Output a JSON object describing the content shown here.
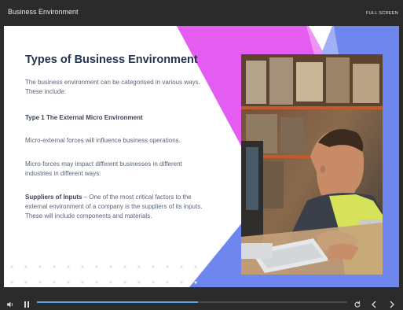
{
  "window": {
    "title": "Business Environment",
    "fullscreen_label": "FULL SCREEN"
  },
  "slide": {
    "heading": "Types of Business Environment",
    "intro": "The business environment can be categorised in various ways. These include:",
    "subheading": "Type 1 The External Micro Environment",
    "para1": "Micro-external forces will influence business operations.",
    "para2": "Micro-forces may impact different businesses in different industries in different ways:",
    "suppliers_label": "Suppliers of Inputs",
    "suppliers_text": " – One of the most critical factors to the external environment of a company is the suppliers of its inputs. These will include components and materials."
  },
  "colors": {
    "magenta": "#e45cf0",
    "blue": "#6e86ee",
    "progress": "#5aa6e8"
  },
  "player": {
    "progress": 0.52,
    "icons": [
      "volume-icon",
      "pause-icon",
      "replay-icon",
      "previous-icon",
      "next-icon"
    ]
  }
}
